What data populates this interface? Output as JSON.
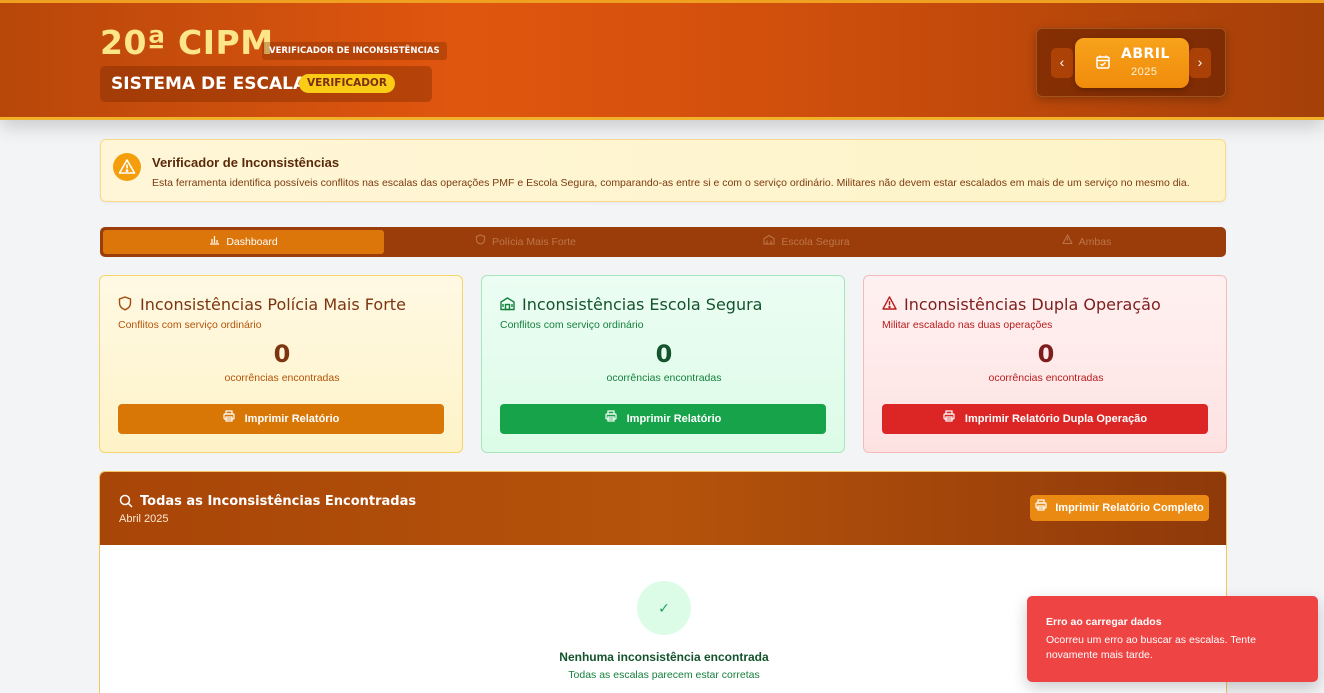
{
  "header": {
    "brand_title": "20ª CIPM",
    "brand_tag": "VERIFICADOR DE INCONSISTÊNCIAS",
    "system_label": "SISTEMA DE ESCALA",
    "system_badge": "VERIFICADOR",
    "month_nav": {
      "prev": "‹",
      "next": "›",
      "month": "ABRIL",
      "year": "2025",
      "icon": "calendar-check-icon"
    }
  },
  "info_banner": {
    "icon": "warning-icon",
    "title": "Verificador de Inconsistências",
    "text": "Esta ferramenta identifica possíveis conflitos nas escalas das operações PMF e Escola Segura, comparando-as entre si e com o serviço ordinário. Militares não devem estar escalados em mais de um serviço no mesmo dia."
  },
  "tabs": [
    {
      "label": "Dashboard",
      "icon": "bar-chart-icon",
      "active": true
    },
    {
      "label": "Polícia Mais Forte",
      "icon": "shield-icon",
      "active": false
    },
    {
      "label": "Escola Segura",
      "icon": "school-icon",
      "active": false
    },
    {
      "label": "Ambas",
      "icon": "warning-icon",
      "active": false
    }
  ],
  "cards": {
    "pmf": {
      "icon": "shield-icon",
      "title": "Inconsistências Polícia Mais Forte",
      "subtitle": "Conflitos com serviço ordinário",
      "count": "0",
      "count_label": "ocorrências encontradas",
      "button": "Imprimir Relatório",
      "color": "#d97706"
    },
    "es": {
      "icon": "school-icon",
      "title": "Inconsistências Escola Segura",
      "subtitle": "Conflitos com serviço ordinário",
      "count": "0",
      "count_label": "ocorrências encontradas",
      "button": "Imprimir Relatório",
      "color": "#16a34a"
    },
    "dup": {
      "icon": "warning-icon",
      "title": "Inconsistências Dupla Operação",
      "subtitle": "Militar escalado nas duas operações",
      "count": "0",
      "count_label": "ocorrências encontradas",
      "button": "Imprimir Relatório Dupla Operação",
      "color": "#dc2626"
    }
  },
  "all_panel": {
    "icon": "search-icon",
    "title": "Todas as Inconsistências Encontradas",
    "period": "Abril 2025",
    "button": "Imprimir Relatório Completo",
    "empty_icon": "✓",
    "empty_title": "Nenhuma inconsistência encontrada",
    "empty_sub": "Todas as escalas parecem estar corretas"
  },
  "toast": {
    "title": "Erro ao carregar dados",
    "message": "Ocorreu um erro ao buscar as escalas. Tente novamente mais tarde.",
    "color": "#ef4444"
  }
}
